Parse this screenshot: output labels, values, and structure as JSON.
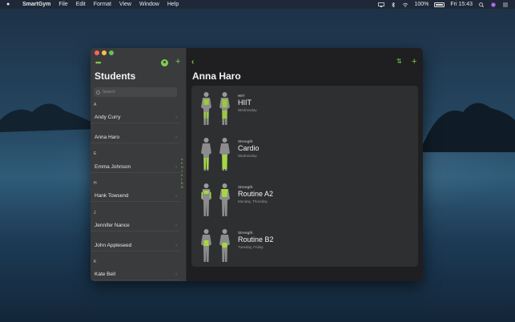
{
  "menubar": {
    "app_name": "SmartGym",
    "menus": [
      "File",
      "Edit",
      "Format",
      "View",
      "Window",
      "Help"
    ],
    "battery": "100%",
    "clock": "Fri 15:43"
  },
  "sidebar": {
    "title": "Students",
    "search_placeholder": "Search",
    "sections": [
      {
        "letter": "A",
        "items": [
          "Andy Curry",
          "Anna Haro"
        ]
      },
      {
        "letter": "E",
        "items": [
          "Emma Johnson"
        ]
      },
      {
        "letter": "H",
        "items": [
          "Hank Towsend"
        ]
      },
      {
        "letter": "J",
        "items": [
          "Jennifer Nance",
          "John Appleseed"
        ]
      },
      {
        "letter": "K",
        "items": [
          "Kate Bell"
        ]
      }
    ],
    "index": [
      "A",
      "E",
      "H",
      "J",
      "K",
      "L",
      "B",
      "R"
    ]
  },
  "detail": {
    "title": "Anna Haro",
    "routines": [
      {
        "category": "HIIT",
        "name": "HIIT",
        "days": "Wednesday"
      },
      {
        "category": "Strength",
        "name": "Cardio",
        "days": "Wednesday"
      },
      {
        "category": "Strength",
        "name": "Routine A2",
        "days": "Monday, Thursday"
      },
      {
        "category": "Strength",
        "name": "Routine B2",
        "days": "Tuesday, Friday"
      }
    ]
  },
  "colors": {
    "accent": "#7cd04a",
    "sidebar_bg": "#3a3b3d",
    "main_bg": "#1f1f21",
    "card_bg": "#2e2f31"
  }
}
